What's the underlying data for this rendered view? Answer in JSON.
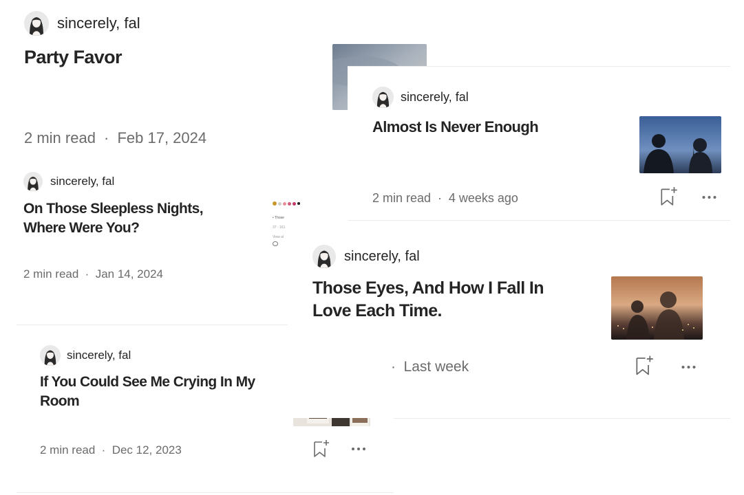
{
  "cards": [
    {
      "author": "sincerely, fal",
      "title": "Party Favor",
      "read_time": "2 min read",
      "sep": "·",
      "date": "Feb 17, 2024"
    },
    {
      "author": "sincerely, fal",
      "title": "On Those Sleepless Nights, Where Were You?",
      "read_time": "2 min read",
      "sep": "·",
      "date": "Jan 14, 2024",
      "edge_snippet": "• Those",
      "edge_snippet_2": "37 · 161",
      "edge_snippet_3": "View al"
    },
    {
      "author": "sincerely, fal",
      "title": "If You Could See Me Crying In My Room",
      "read_time": "2 min read",
      "sep": "·",
      "date": "Dec 12, 2023"
    },
    {
      "author": "sincerely, fal",
      "title": "Almost Is Never Enough",
      "read_time": "2 min read",
      "sep": "·",
      "date": "4 weeks ago"
    },
    {
      "author": "sincerely, fal",
      "title": "Those Eyes, And How I Fall In Love Each Time.",
      "sep": "·",
      "date": "Last week"
    }
  ],
  "icons": {
    "bookmark": "bookmark-add-icon",
    "more": "more-horizontal-icon"
  },
  "colors": {
    "text": "#242424",
    "muted": "#6b6b6b",
    "divider": "#ebebeb"
  }
}
